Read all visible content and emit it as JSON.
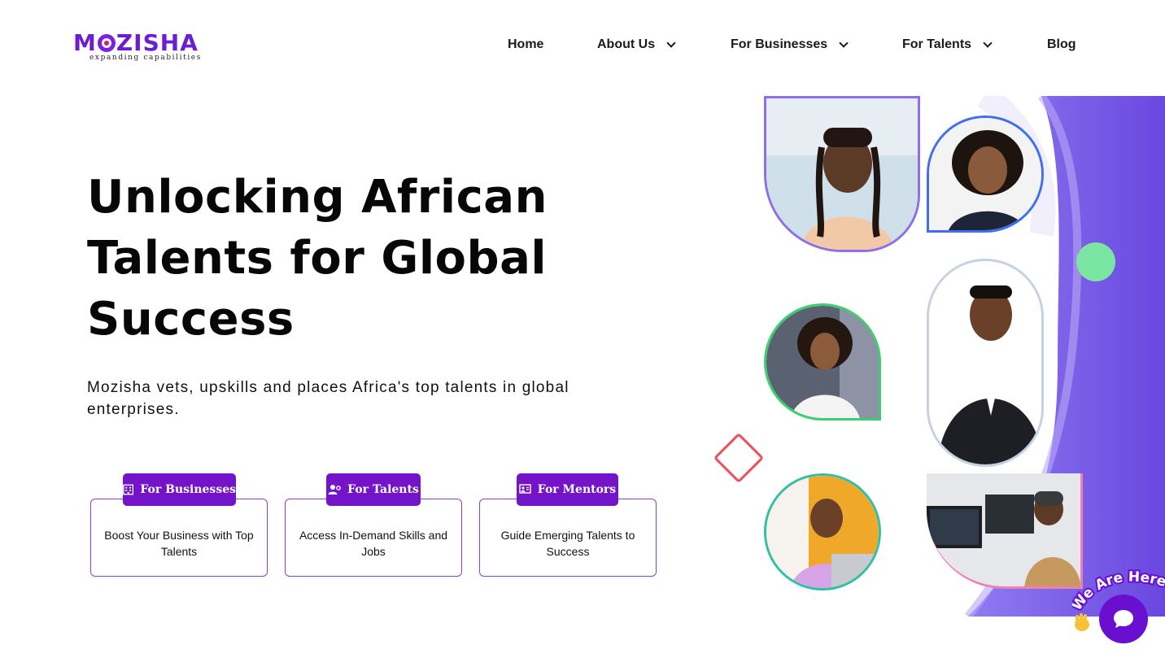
{
  "brand": {
    "name": "MOZISHA",
    "tagline": "expanding capabilities"
  },
  "nav": {
    "home": "Home",
    "about": "About Us",
    "businesses": "For Businesses",
    "talents": "For Talents",
    "blog": "Blog"
  },
  "hero": {
    "title_line1": "Unlocking African",
    "title_line2": "Talents for Global",
    "title_line3": "Success",
    "subtitle": "Mozisha vets, upskills and places Africa's top talents in global enterprises."
  },
  "cards": [
    {
      "button": "For Businesses",
      "text": "Boost Your Business with Top Talents",
      "icon": "building-icon"
    },
    {
      "button": "For Talents",
      "text": "Access In-Demand Skills and Jobs",
      "icon": "user-gear-icon"
    },
    {
      "button": "For Mentors",
      "text": "Guide Emerging Talents to Success",
      "icon": "mentor-board-icon"
    }
  ],
  "chat": {
    "label": "We Are Here!",
    "icon": "chat-icon"
  },
  "colors": {
    "brand_purple": "#7414c9",
    "card_border": "#8a3fd6",
    "collage_purple": "#7b5ce6",
    "accent_green": "#7be5a2",
    "accent_red": "#ee4f5a"
  }
}
